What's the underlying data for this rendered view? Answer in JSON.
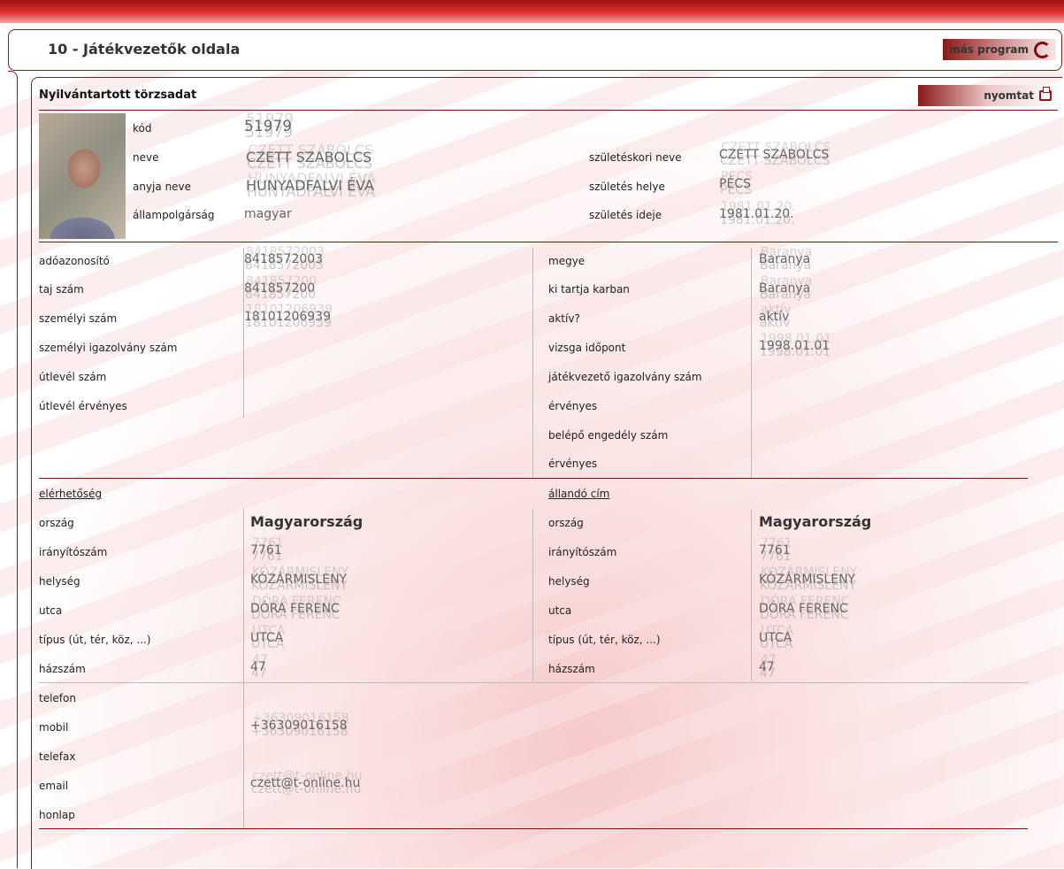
{
  "header": {
    "title": "10 - Játékvezetők oldala",
    "program_button": "más program",
    "program_icon": "refresh-icon"
  },
  "section": {
    "title": "Nyilvántartott törzsadat",
    "print_button": "nyomtat",
    "print_icon": "printer-icon"
  },
  "person": {
    "kod": {
      "label": "kód",
      "value": "51979"
    },
    "neve": {
      "label": "neve",
      "value": "CZETT SZABOLCS"
    },
    "anyja_neve": {
      "label": "anyja neve",
      "value": "HUNYADFALVI ÉVA"
    },
    "allampolgarsag": {
      "label": "állampolgárság",
      "value": "magyar"
    },
    "szuleteskori_neve": {
      "label": "születéskori neve",
      "value": "CZETT SZABOLCS"
    },
    "szuletes_helye": {
      "label": "születés helye",
      "value": "PÉCS"
    },
    "szuletes_ideje": {
      "label": "születés ideje",
      "value": "1981.01.20."
    }
  },
  "ids": {
    "adoazonosito": {
      "label": "adóazonosító",
      "value": "8418572003"
    },
    "taj": {
      "label": "taj szám",
      "value": "841857200"
    },
    "szemelyi": {
      "label": "személyi szám",
      "value": "18101206939"
    },
    "igazolvany": {
      "label": "személyi igazolvány szám",
      "value": ""
    },
    "utlevel": {
      "label": "útlevél szám",
      "value": ""
    },
    "utlevel_ervenyes": {
      "label": "útlevél érvényes",
      "value": ""
    }
  },
  "ref": {
    "megye": {
      "label": "megye",
      "value": "Baranya"
    },
    "karban": {
      "label": "ki tartja karban",
      "value": "Baranya"
    },
    "aktiv": {
      "label": "aktív?",
      "value": "aktív"
    },
    "vizsga": {
      "label": "vizsga időpont",
      "value": "1998.01.01"
    },
    "jv_igazolvany": {
      "label": "játékvezető igazolvány szám",
      "value": ""
    },
    "ervenyes1": {
      "label": "érvényes",
      "value": ""
    },
    "belepo": {
      "label": "belépő engedély szám",
      "value": ""
    },
    "ervenyes2": {
      "label": "érvényes",
      "value": ""
    }
  },
  "contact_address": {
    "heading": "elérhetőség",
    "orszag": {
      "label": "ország",
      "value": "Magyarország"
    },
    "irsz": {
      "label": "irányítószám",
      "value": "7761"
    },
    "helyseg": {
      "label": "helység",
      "value": "KÓZÁRMISLENY"
    },
    "utca": {
      "label": "utca",
      "value": "DÓRA FERENC"
    },
    "tipus": {
      "label": "típus (út, tér, köz, ...)",
      "value": "UTCA"
    },
    "hazszam": {
      "label": "házszám",
      "value": "47"
    }
  },
  "permanent_address": {
    "heading": "állandó cím",
    "orszag": {
      "label": "ország",
      "value": "Magyarország"
    },
    "irsz": {
      "label": "irányítószám",
      "value": "7761"
    },
    "helyseg": {
      "label": "helység",
      "value": "KÓZÁRMISLENY"
    },
    "utca": {
      "label": "utca",
      "value": "DÓRA FERENC"
    },
    "tipus": {
      "label": "típus (út, tér, köz, ...)",
      "value": "UTCA"
    },
    "hazszam": {
      "label": "házszám",
      "value": "47"
    }
  },
  "phones": {
    "telefon": {
      "label": "telefon",
      "value": ""
    },
    "mobil": {
      "label": "mobil",
      "value": "+36309016158"
    },
    "telefax": {
      "label": "telefax",
      "value": ""
    },
    "email": {
      "label": "email",
      "value": "czett@t-online.hu"
    },
    "honlap": {
      "label": "honlap",
      "value": ""
    }
  }
}
